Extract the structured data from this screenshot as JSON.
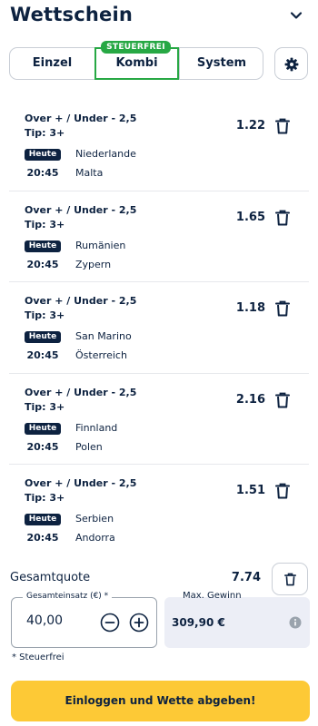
{
  "header": {
    "title": "Wettschein"
  },
  "tabs": {
    "einzel": "Einzel",
    "kombi": "Kombi",
    "system": "System",
    "badge": "STEUERFREI"
  },
  "bets": [
    {
      "market": "Over + / Under - 2,5",
      "tip": "Tip: 3+",
      "odds": "1.22",
      "day": "Heute",
      "time": "20:45",
      "team1": "Niederlande",
      "team2": "Malta"
    },
    {
      "market": "Over + / Under - 2,5",
      "tip": "Tip: 3+",
      "odds": "1.65",
      "day": "Heute",
      "time": "20:45",
      "team1": "Rumänien",
      "team2": "Zypern"
    },
    {
      "market": "Over + / Under - 2,5",
      "tip": "Tip: 3+",
      "odds": "1.18",
      "day": "Heute",
      "time": "20:45",
      "team1": "San Marino",
      "team2": "Österreich"
    },
    {
      "market": "Over + / Under - 2,5",
      "tip": "Tip: 3+",
      "odds": "2.16",
      "day": "Heute",
      "time": "20:45",
      "team1": "Finnland",
      "team2": "Polen"
    },
    {
      "market": "Over + / Under - 2,5",
      "tip": "Tip: 3+",
      "odds": "1.51",
      "day": "Heute",
      "time": "20:45",
      "team1": "Serbien",
      "team2": "Andorra"
    }
  ],
  "summary": {
    "total_label": "Gesamtquote",
    "total_odds": "7.74"
  },
  "stake": {
    "label": "Gesamteinsatz (€) *",
    "value": "40,00"
  },
  "win": {
    "label": "Max. Gewinn",
    "value": "309,90 €"
  },
  "footnote": "* Steuerfrei",
  "submit": "Einloggen und Wette abgeben!",
  "colors": {
    "navy": "#0d2240",
    "green": "#27a844",
    "yellow": "#fdc936",
    "win_bg": "#eceef6",
    "border": "#c9ced6"
  },
  "icons": [
    "chevron-down-icon",
    "gear-icon",
    "trash-icon",
    "minus-circle-icon",
    "plus-circle-icon",
    "info-icon"
  ]
}
